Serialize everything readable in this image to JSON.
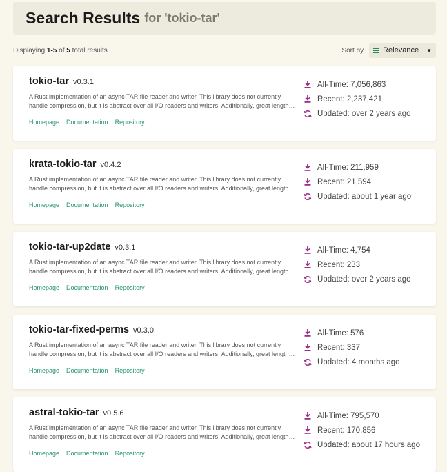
{
  "header": {
    "title": "Search Results",
    "subtitle": "for 'tokio-tar'"
  },
  "toolbar": {
    "displaying_prefix": "Displaying ",
    "range": "1-5",
    "of_text": " of ",
    "total": "5",
    "suffix": " total results",
    "sort_label": "Sort by",
    "sort_value": "Relevance"
  },
  "colors": {
    "accent": "#27966a",
    "icon": "#9b2d8a",
    "background": "#f9f7ec"
  },
  "results": [
    {
      "name": "tokio-tar",
      "version": "v0.3.1",
      "description": "A Rust implementation of an async TAR file reader and writer. This library does not currently handle compression, but it is abstract over all I/O readers and writers. Additionally, great lengths are t …",
      "links": [
        "Homepage",
        "Documentation",
        "Repository"
      ],
      "all_time": "All-Time: 7,056,863",
      "recent": "Recent: 2,237,421",
      "updated": "Updated: over 2 years ago"
    },
    {
      "name": "krata-tokio-tar",
      "version": "v0.4.2",
      "description": "A Rust implementation of an async TAR file reader and writer. This library does not currently handle compression, but it is abstract over all I/O readers and writers. Additionally, great lengths are t …",
      "links": [
        "Homepage",
        "Documentation",
        "Repository"
      ],
      "all_time": "All-Time: 211,959",
      "recent": "Recent: 21,594",
      "updated": "Updated: about 1 year ago"
    },
    {
      "name": "tokio-tar-up2date",
      "version": "v0.3.1",
      "description": "A Rust implementation of an async TAR file reader and writer. This library does not currently handle compression, but it is abstract over all I/O readers and writers. Additionally, great lengths are t …",
      "links": [
        "Homepage",
        "Documentation",
        "Repository"
      ],
      "all_time": "All-Time: 4,754",
      "recent": "Recent: 233",
      "updated": "Updated: over 2 years ago"
    },
    {
      "name": "tokio-tar-fixed-perms",
      "version": "v0.3.0",
      "description": "A Rust implementation of an async TAR file reader and writer. This library does not currently handle compression, but it is abstract over all I/O readers and writers. Additionally, great lengths are t …",
      "links": [
        "Homepage",
        "Documentation",
        "Repository"
      ],
      "all_time": "All-Time: 576",
      "recent": "Recent: 337",
      "updated": "Updated: 4 months ago"
    },
    {
      "name": "astral-tokio-tar",
      "version": "v0.5.6",
      "description": "A Rust implementation of an async TAR file reader and writer. This library does not currently handle compression, but it is abstract over all I/O readers and writers. Additionally, great lengths are t …",
      "links": [
        "Homepage",
        "Documentation",
        "Repository"
      ],
      "all_time": "All-Time: 795,570",
      "recent": "Recent: 170,856",
      "updated": "Updated: about 17 hours ago"
    }
  ]
}
